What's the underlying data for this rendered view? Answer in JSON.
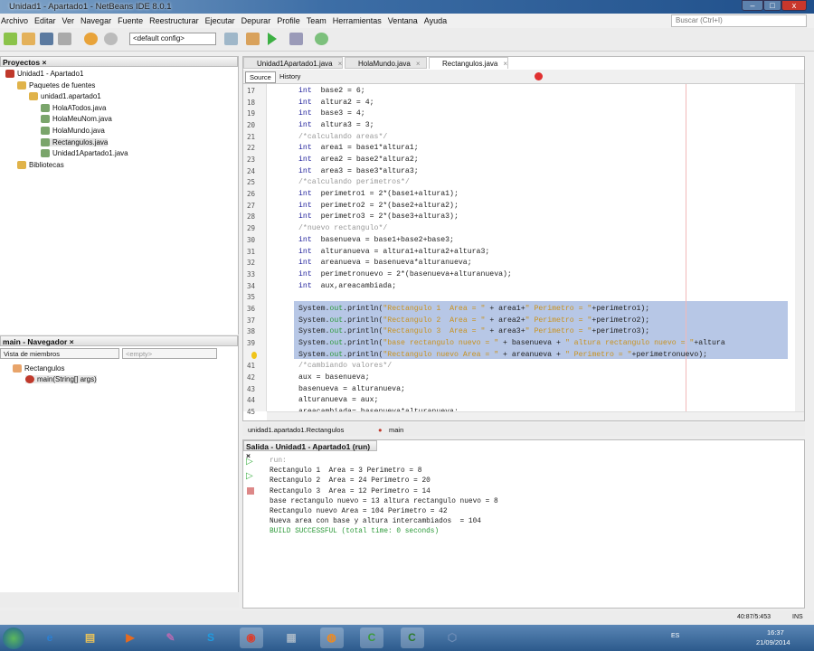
{
  "window": {
    "title": "Unidad1 - Apartado1 - NetBeans IDE 8.0.1",
    "min": "–",
    "max": "□",
    "close": "x"
  },
  "menu": [
    "Archivo",
    "Editar",
    "Ver",
    "Navegar",
    "Fuente",
    "Reestructurar",
    "Ejecutar",
    "Depurar",
    "Profile",
    "Team",
    "Herramientas",
    "Ventana",
    "Ayuda"
  ],
  "toolbar": {
    "config": "<default config>",
    "search_placeholder": "Buscar (Ctrl+I)"
  },
  "projects": {
    "title": "Proyectos",
    "tree": [
      {
        "label": "Unidad1 - Apartado1",
        "depth": 0,
        "color": "#c0392b"
      },
      {
        "label": "Paquetes de fuentes",
        "depth": 1,
        "color": "#e0b34a"
      },
      {
        "label": "unidad1.apartado1",
        "depth": 2,
        "color": "#e0b34a"
      },
      {
        "label": "HolaATodos.java",
        "depth": 3,
        "color": "#7aa56b"
      },
      {
        "label": "HolaMeuNom.java",
        "depth": 3,
        "color": "#7aa56b"
      },
      {
        "label": "HolaMundo.java",
        "depth": 3,
        "color": "#7aa56b"
      },
      {
        "label": "Rectangulos.java",
        "depth": 3,
        "color": "#7aa56b",
        "selected": true
      },
      {
        "label": "Unidad1Apartado1.java",
        "depth": 3,
        "color": "#7aa56b"
      },
      {
        "label": "Bibliotecas",
        "depth": 1,
        "color": "#e0b34a"
      }
    ]
  },
  "navigator": {
    "title": "main - Navegador",
    "view": "Vista de miembros",
    "filter": "<empty>",
    "tree": [
      {
        "label": "Rectangulos"
      },
      {
        "label": "main(String[] args)"
      }
    ]
  },
  "editor": {
    "tabs": [
      "Unidad1Apartado1.java",
      "HolaMundo.java",
      "Rectangulos.java"
    ],
    "active_tab": 2,
    "source": "Source",
    "history": "History",
    "lines": [
      {
        "n": "17",
        "s": [
          [
            "kw",
            "int"
          ],
          [
            "",
            "  base2 = 6;"
          ]
        ]
      },
      {
        "n": "18",
        "s": [
          [
            "kw",
            "int"
          ],
          [
            "",
            "  altura2 = 4;"
          ]
        ]
      },
      {
        "n": "19",
        "s": [
          [
            "kw",
            "int"
          ],
          [
            "",
            "  base3 = 4;"
          ]
        ]
      },
      {
        "n": "20",
        "s": [
          [
            "kw",
            "int"
          ],
          [
            "",
            "  altura3 = 3;"
          ]
        ]
      },
      {
        "n": "21",
        "s": [
          [
            "cm",
            "/*calculando areas*/"
          ]
        ]
      },
      {
        "n": "22",
        "s": [
          [
            "kw",
            "int"
          ],
          [
            "",
            "  area1 = base1*altura1;"
          ]
        ]
      },
      {
        "n": "23",
        "s": [
          [
            "kw",
            "int"
          ],
          [
            "",
            "  area2 = base2*altura2;"
          ]
        ]
      },
      {
        "n": "24",
        "s": [
          [
            "kw",
            "int"
          ],
          [
            "",
            "  area3 = base3*altura3;"
          ]
        ]
      },
      {
        "n": "25",
        "s": [
          [
            "cm",
            "/*calculando perimetros*/"
          ]
        ]
      },
      {
        "n": "26",
        "s": [
          [
            "kw",
            "int"
          ],
          [
            "",
            "  perimetro1 = 2*(base1+altura1);"
          ]
        ]
      },
      {
        "n": "27",
        "s": [
          [
            "kw",
            "int"
          ],
          [
            "",
            "  perimetro2 = 2*(base2+altura2);"
          ]
        ]
      },
      {
        "n": "28",
        "s": [
          [
            "kw",
            "int"
          ],
          [
            "",
            "  perimetro3 = 2*(base3+altura3);"
          ]
        ]
      },
      {
        "n": "29",
        "s": [
          [
            "cm",
            "/*nuevo rectangulo*/"
          ]
        ]
      },
      {
        "n": "30",
        "s": [
          [
            "kw",
            "int"
          ],
          [
            "",
            "  basenueva = base1+base2+base3;"
          ]
        ]
      },
      {
        "n": "31",
        "s": [
          [
            "kw",
            "int"
          ],
          [
            "",
            "  alturanueva = altura1+altura2+altura3;"
          ]
        ]
      },
      {
        "n": "32",
        "s": [
          [
            "kw",
            "int"
          ],
          [
            "",
            "  areanueva = basenueva*alturanueva;"
          ]
        ]
      },
      {
        "n": "33",
        "s": [
          [
            "kw",
            "int"
          ],
          [
            "",
            "  perimetronuevo = 2*(basenueva+alturanueva);"
          ]
        ]
      },
      {
        "n": "34",
        "s": [
          [
            "kw",
            "int"
          ],
          [
            "",
            "  aux,areacambiada;"
          ]
        ]
      },
      {
        "n": "35",
        "s": []
      },
      {
        "n": "36",
        "s": [
          [
            "",
            "System."
          ],
          [
            "fld",
            "out"
          ],
          [
            "",
            ".println("
          ],
          [
            "st",
            "\"Rectangulo 1  Area = \""
          ],
          [
            "",
            " + area1+"
          ],
          [
            "st",
            "\" Perimetro = \""
          ],
          [
            "",
            "+perimetro1);"
          ]
        ]
      },
      {
        "n": "37",
        "s": [
          [
            "",
            "System."
          ],
          [
            "fld",
            "out"
          ],
          [
            "",
            ".println("
          ],
          [
            "st",
            "\"Rectangulo 2  Area = \""
          ],
          [
            "",
            " + area2+"
          ],
          [
            "st",
            "\" Perimetro = \""
          ],
          [
            "",
            "+perimetro2);"
          ]
        ]
      },
      {
        "n": "38",
        "s": [
          [
            "",
            "System."
          ],
          [
            "fld",
            "out"
          ],
          [
            "",
            ".println("
          ],
          [
            "st",
            "\"Rectangulo 3  Area = \""
          ],
          [
            "",
            " + area3+"
          ],
          [
            "st",
            "\" Perimetro = \""
          ],
          [
            "",
            "+perimetro3);"
          ]
        ]
      },
      {
        "n": "39",
        "s": [
          [
            "",
            "System."
          ],
          [
            "fld",
            "out"
          ],
          [
            "",
            ".println("
          ],
          [
            "st",
            "\"base rectangulo nuevo = \""
          ],
          [
            "",
            " + basenueva + "
          ],
          [
            "st",
            "\" altura rectangulo nuevo = \""
          ],
          [
            "",
            "+altura"
          ]
        ]
      },
      {
        "n": "",
        "s": [
          [
            "",
            "System."
          ],
          [
            "fld",
            "out"
          ],
          [
            "",
            ".println("
          ],
          [
            "st",
            "\"Rectangulo nuevo Area = \""
          ],
          [
            "",
            " + areanueva + "
          ],
          [
            "st",
            "\" Perimetro = \""
          ],
          [
            "",
            "+perimetronuevo);"
          ]
        ]
      },
      {
        "n": "41",
        "s": [
          [
            "cm",
            "/*cambiando valores*/"
          ]
        ]
      },
      {
        "n": "42",
        "s": [
          [
            "",
            "aux = basenueva;"
          ]
        ]
      },
      {
        "n": "43",
        "s": [
          [
            "",
            "basenueva = alturanueva;"
          ]
        ]
      },
      {
        "n": "44",
        "s": [
          [
            "",
            "alturanueva = aux;"
          ]
        ]
      },
      {
        "n": "45",
        "s": [
          [
            "",
            "areacambiada= basenueva*alturanueva;"
          ]
        ]
      }
    ]
  },
  "breadcrumb": [
    "unidad1.apartado1.Rectangulos",
    "main"
  ],
  "output": {
    "title": "Salida - Unidad1 - Apartado1 (run)",
    "lines": [
      {
        "t": "run:",
        "c": "#999"
      },
      {
        "t": "Rectangulo 1  Area = 3 Perimetro = 8",
        "c": "#222"
      },
      {
        "t": "Rectangulo 2  Area = 24 Perimetro = 20",
        "c": "#222"
      },
      {
        "t": "Rectangulo 3  Area = 12 Perimetro = 14",
        "c": "#222"
      },
      {
        "t": "base rectangulo nuevo = 13 altura rectangulo nuevo = 8",
        "c": "#222"
      },
      {
        "t": "Rectangulo nuevo Area = 104 Perimetro = 42",
        "c": "#222"
      },
      {
        "t": "Nueva area con base y altura intercambiados  = 104",
        "c": "#222"
      },
      {
        "t": "BUILD SUCCESSFUL (total time: 0 seconds)",
        "c": "#2d9a3a"
      }
    ]
  },
  "status": {
    "position": "40:87/5:453",
    "mode": "INS"
  },
  "taskbar": {
    "lang": "ES",
    "time": "16:37",
    "date": "21/09/2014",
    "apps": [
      {
        "name": "internet-explorer",
        "g": "e",
        "c": "#2a7fd4"
      },
      {
        "name": "file-explorer",
        "g": "▤",
        "c": "#e8c25a"
      },
      {
        "name": "media-player",
        "g": "▶",
        "c": "#e66a1f"
      },
      {
        "name": "paint",
        "g": "✎",
        "c": "#b36ab0"
      },
      {
        "name": "skype",
        "g": "S",
        "c": "#1e9be0"
      },
      {
        "name": "chrome",
        "g": "◉",
        "c": "#d93f2f"
      },
      {
        "name": "calculator",
        "g": "▦",
        "c": "#a6b6c6"
      },
      {
        "name": "netbeans-app",
        "g": "◍",
        "c": "#f08a1e"
      },
      {
        "name": "camtasia",
        "g": "C",
        "c": "#3c9a3c"
      },
      {
        "name": "camtasia-recorder",
        "g": "C",
        "c": "#2d7a2d"
      },
      {
        "name": "virtualbox",
        "g": "⬡",
        "c": "#6d8cb6"
      }
    ]
  }
}
